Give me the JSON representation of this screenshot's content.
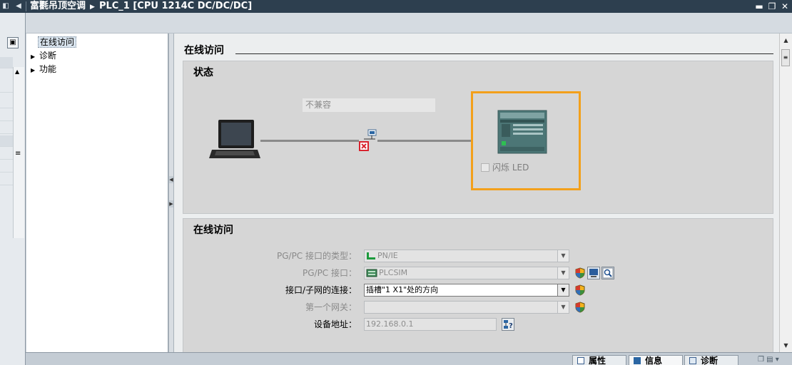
{
  "window": {
    "project": "富氍吊顶空调",
    "device": "PLC_1 [CPU 1214C DC/DC/DC]",
    "controls": [
      "minimize-icon",
      "restore-icon",
      "close-icon"
    ]
  },
  "nav": {
    "items": [
      {
        "label": "在线访问",
        "selected": true,
        "expandable": false
      },
      {
        "label": "诊断",
        "selected": false,
        "expandable": true
      },
      {
        "label": "功能",
        "selected": false,
        "expandable": true
      }
    ]
  },
  "content": {
    "page_title": "在线访问",
    "status_section": {
      "title": "状态",
      "compat_text": "不兼容",
      "flash_label": "闪烁 LED"
    },
    "online_section": {
      "title": "在线访问",
      "rows": [
        {
          "label": "PG/PC 接口的类型：",
          "value": "PN/IE",
          "enabled": false
        },
        {
          "label": "PG/PC 接口：",
          "value": "PLCSIM",
          "enabled": false
        },
        {
          "label": "接口/子网的连接：",
          "value": "插槽\"1 X1\"处的方向",
          "enabled": true
        },
        {
          "label": "第一个网关：",
          "value": "",
          "enabled": false
        },
        {
          "label": "设备地址：",
          "value": "192.168.0.1",
          "enabled": false
        }
      ]
    }
  },
  "inspector_tabs": [
    {
      "label": "属性",
      "icon": "properties-icon"
    },
    {
      "label": "信息",
      "icon": "info-icon"
    },
    {
      "label": "诊断",
      "icon": "diagnostics-icon"
    }
  ],
  "colors": {
    "titlebar": "#2d3f4f",
    "highlight_frame": "#f3a01b",
    "error": "#d9232e"
  }
}
